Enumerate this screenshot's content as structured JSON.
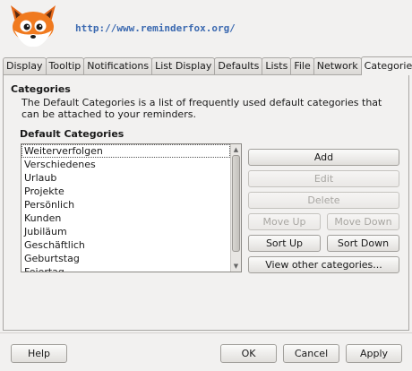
{
  "header": {
    "logo_icon": "fox-icon",
    "url": "http://www.reminderfox.org/"
  },
  "tabs": [
    {
      "label": "Display"
    },
    {
      "label": "Tooltip"
    },
    {
      "label": "Notifications"
    },
    {
      "label": "List Display"
    },
    {
      "label": "Defaults"
    },
    {
      "label": "Lists"
    },
    {
      "label": "File"
    },
    {
      "label": "Network"
    },
    {
      "label": "Categories",
      "active": true
    }
  ],
  "categories": {
    "title": "Categories",
    "description": "The Default Categories is a list of frequently used default categories that can be attached to your reminders.",
    "list_title": "Default Categories",
    "items": [
      {
        "label": "Weiterverfolgen",
        "selected": true
      },
      {
        "label": "Verschiedenes"
      },
      {
        "label": "Urlaub"
      },
      {
        "label": "Projekte"
      },
      {
        "label": "Persönlich"
      },
      {
        "label": "Kunden"
      },
      {
        "label": "Jubiläum"
      },
      {
        "label": "Geschäftlich"
      },
      {
        "label": "Geburtstag"
      },
      {
        "label": "Feiertag"
      }
    ],
    "buttons": {
      "add": "Add",
      "edit": "Edit",
      "delete": "Delete",
      "move_up": "Move Up",
      "move_down": "Move Down",
      "sort_up": "Sort Up",
      "sort_down": "Sort Down",
      "view_other": "View other categories..."
    }
  },
  "footer": {
    "help": "Help",
    "ok": "OK",
    "cancel": "Cancel",
    "apply": "Apply"
  },
  "colors": {
    "background": "#f2f1f0",
    "link": "#3b69b0",
    "fox_orange": "#f07a1f",
    "disabled_text": "#a8a6a2"
  }
}
